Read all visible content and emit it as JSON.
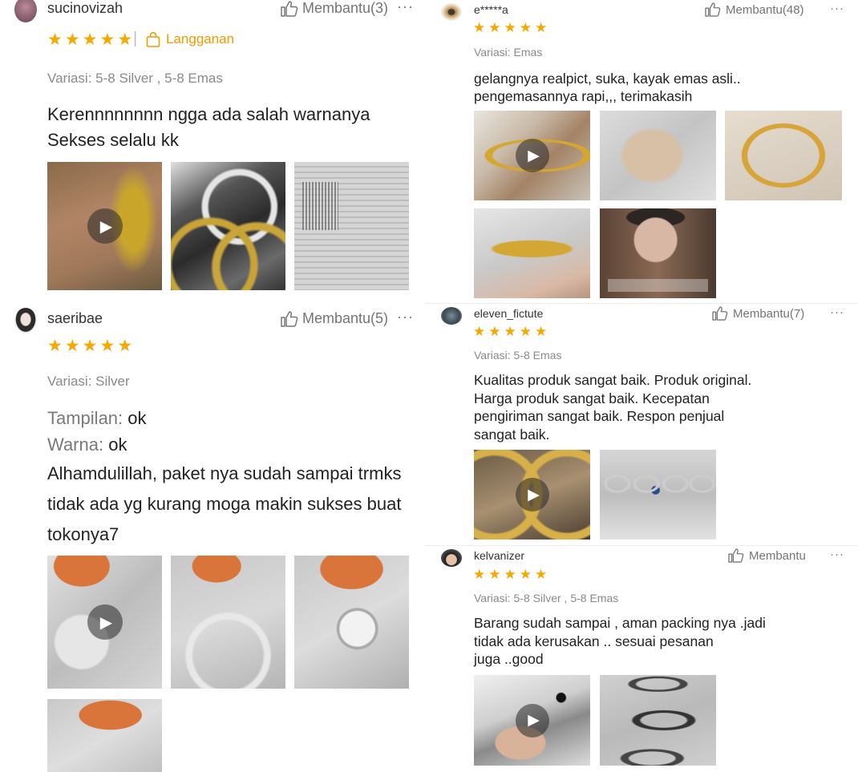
{
  "reviews": [
    {
      "user": "sucinovizah",
      "helpful": "Membantu(3)",
      "more": "···",
      "subscription": "Langganan",
      "variant": "Variasi: 5-8 Silver , 5-8 Emas",
      "lines": [
        "Kerennnnnnnn ngga ada salah warnanya",
        "Sekses selalu kk"
      ]
    },
    {
      "user": "saeribae",
      "helpful": "Membantu(5)",
      "more": "···",
      "variant": "Variasi: Silver",
      "field1_label": "Tampilan: ",
      "field1_value": "ok",
      "field2_label": "Warna: ",
      "field2_value": "ok",
      "lines": [
        "Alhamdulillah, paket nya sudah sampai trmks",
        "tidak ada yg kurang moga makin sukses buat",
        "tokonya7"
      ]
    },
    {
      "user": "e*****a",
      "helpful": "Membantu(48)",
      "more": "···",
      "variant": "Variasi: Emas",
      "lines": [
        "gelangnya realpict, suka, kayak emas asli..",
        "pengemasannya rapi,,, terimakasih"
      ]
    },
    {
      "user": "eleven_fictute",
      "helpful": "Membantu(7)",
      "more": "···",
      "variant": "Variasi: 5-8 Emas",
      "lines": [
        "Kualitas produk sangat baik. Produk original.",
        "Harga produk sangat baik. Kecepatan",
        "pengiriman sangat baik. Respon penjual",
        "sangat baik."
      ]
    },
    {
      "user": "kelvanizer",
      "helpful": "Membantu",
      "more": "···",
      "variant": "Variasi: 5-8 Silver , 5-8 Emas",
      "lines": [
        "Barang sudah sampai , aman packing nya .jadi",
        "tidak ada kerusakan .. sesuai pesanan",
        "juga ..good"
      ]
    }
  ],
  "rating_stars": 5,
  "colors": {
    "star": "#f6a700",
    "subscription": "#f29a00",
    "muted": "#8a8a8a"
  },
  "icons": [
    "thumbs-up-icon",
    "more-icon",
    "shopping-bag-icon",
    "play-icon",
    "star-icon"
  ]
}
